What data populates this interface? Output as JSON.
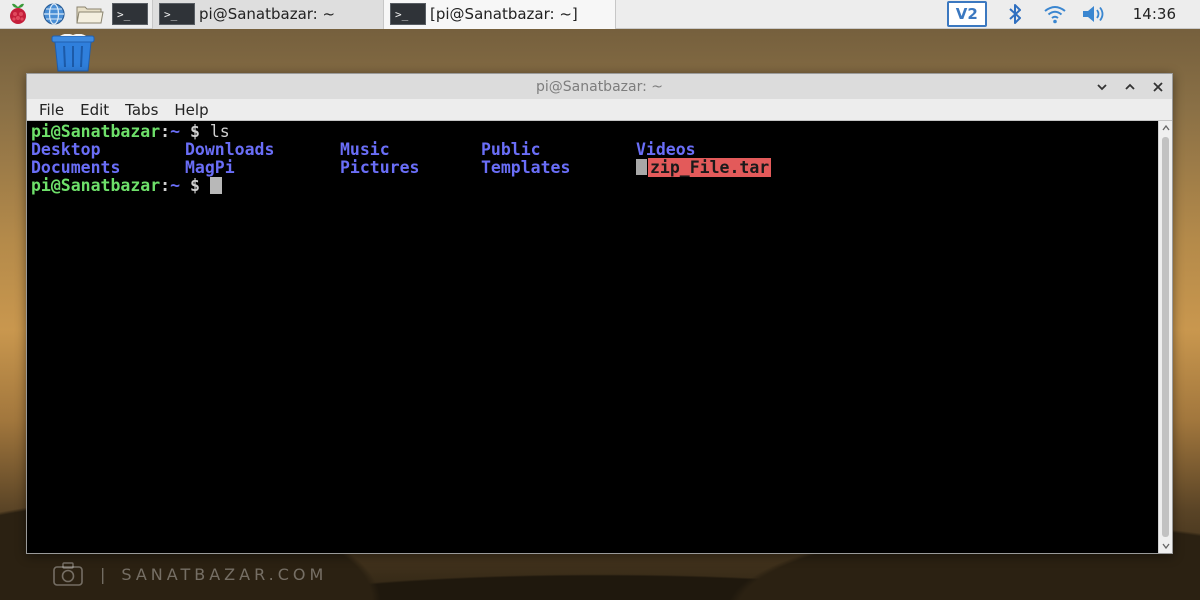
{
  "taskbar": {
    "tasks": [
      {
        "label": "pi@Sanatbazar: ~",
        "icon": "terminal-icon"
      },
      {
        "label": "[pi@Sanatbazar: ~]",
        "icon": "terminal-icon"
      }
    ],
    "launchers": [
      "raspberry-menu-icon",
      "web-browser-icon",
      "file-manager-icon",
      "terminal-icon"
    ],
    "tray": {
      "vnc_label": "V2",
      "clock": "14:36"
    }
  },
  "window": {
    "title": "pi@Sanatbazar: ~",
    "menu": [
      "File",
      "Edit",
      "Tabs",
      "Help"
    ]
  },
  "terminal": {
    "prompt_user": "pi@Sanatbazar",
    "prompt_sep": ":",
    "prompt_path": "~",
    "prompt_symbol": "$",
    "command": "ls",
    "listing_row1": [
      "Desktop",
      "Downloads",
      "Music",
      "Public",
      "Videos"
    ],
    "listing_row2": [
      "Documents",
      "MagPi",
      "Pictures",
      "Templates"
    ],
    "archive_file": "zip_File.tar"
  },
  "watermark": {
    "separator": "|",
    "text": "SANATBAZAR.COM"
  },
  "colors": {
    "prompt": "#6ee06a",
    "directory": "#6a6ef7",
    "archive_bg": "#e35a5a",
    "vnc": "#3b78c0"
  }
}
